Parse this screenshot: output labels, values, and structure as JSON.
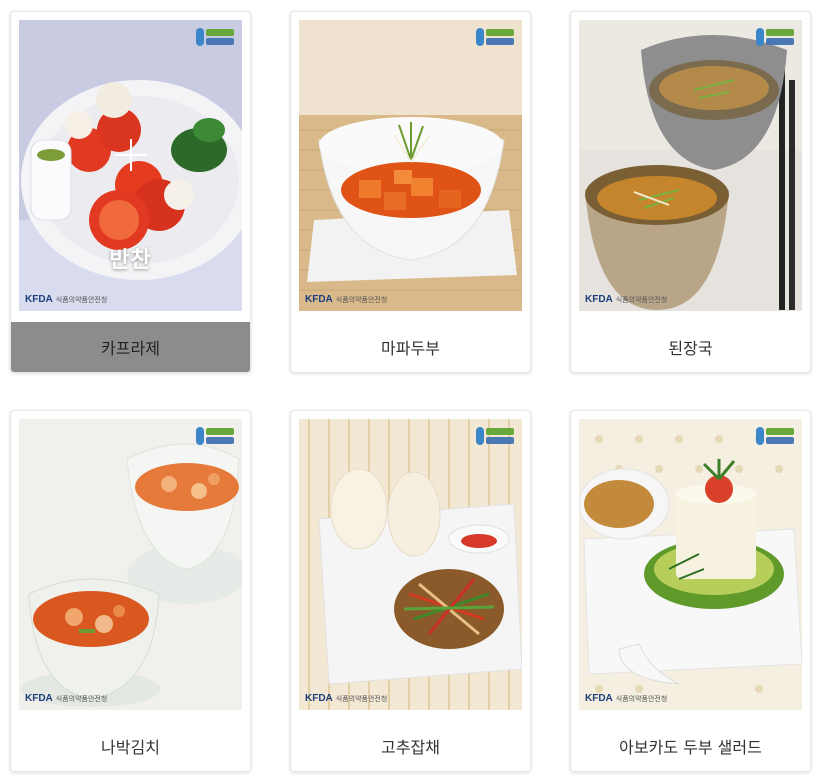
{
  "cards": [
    {
      "title": "카프라제",
      "overlay_label": "반찬",
      "active": true
    },
    {
      "title": "마파두부"
    },
    {
      "title": "된장국"
    },
    {
      "title": "나박김치"
    },
    {
      "title": "고추잡채"
    },
    {
      "title": "아보카도 두부 샐러드"
    }
  ],
  "photo_logo": {
    "brand": "KFDA"
  },
  "colors": {
    "card_border": "#e6e6e6",
    "active_caption_bg": "#8c8c8c",
    "caption_text": "#333333"
  }
}
